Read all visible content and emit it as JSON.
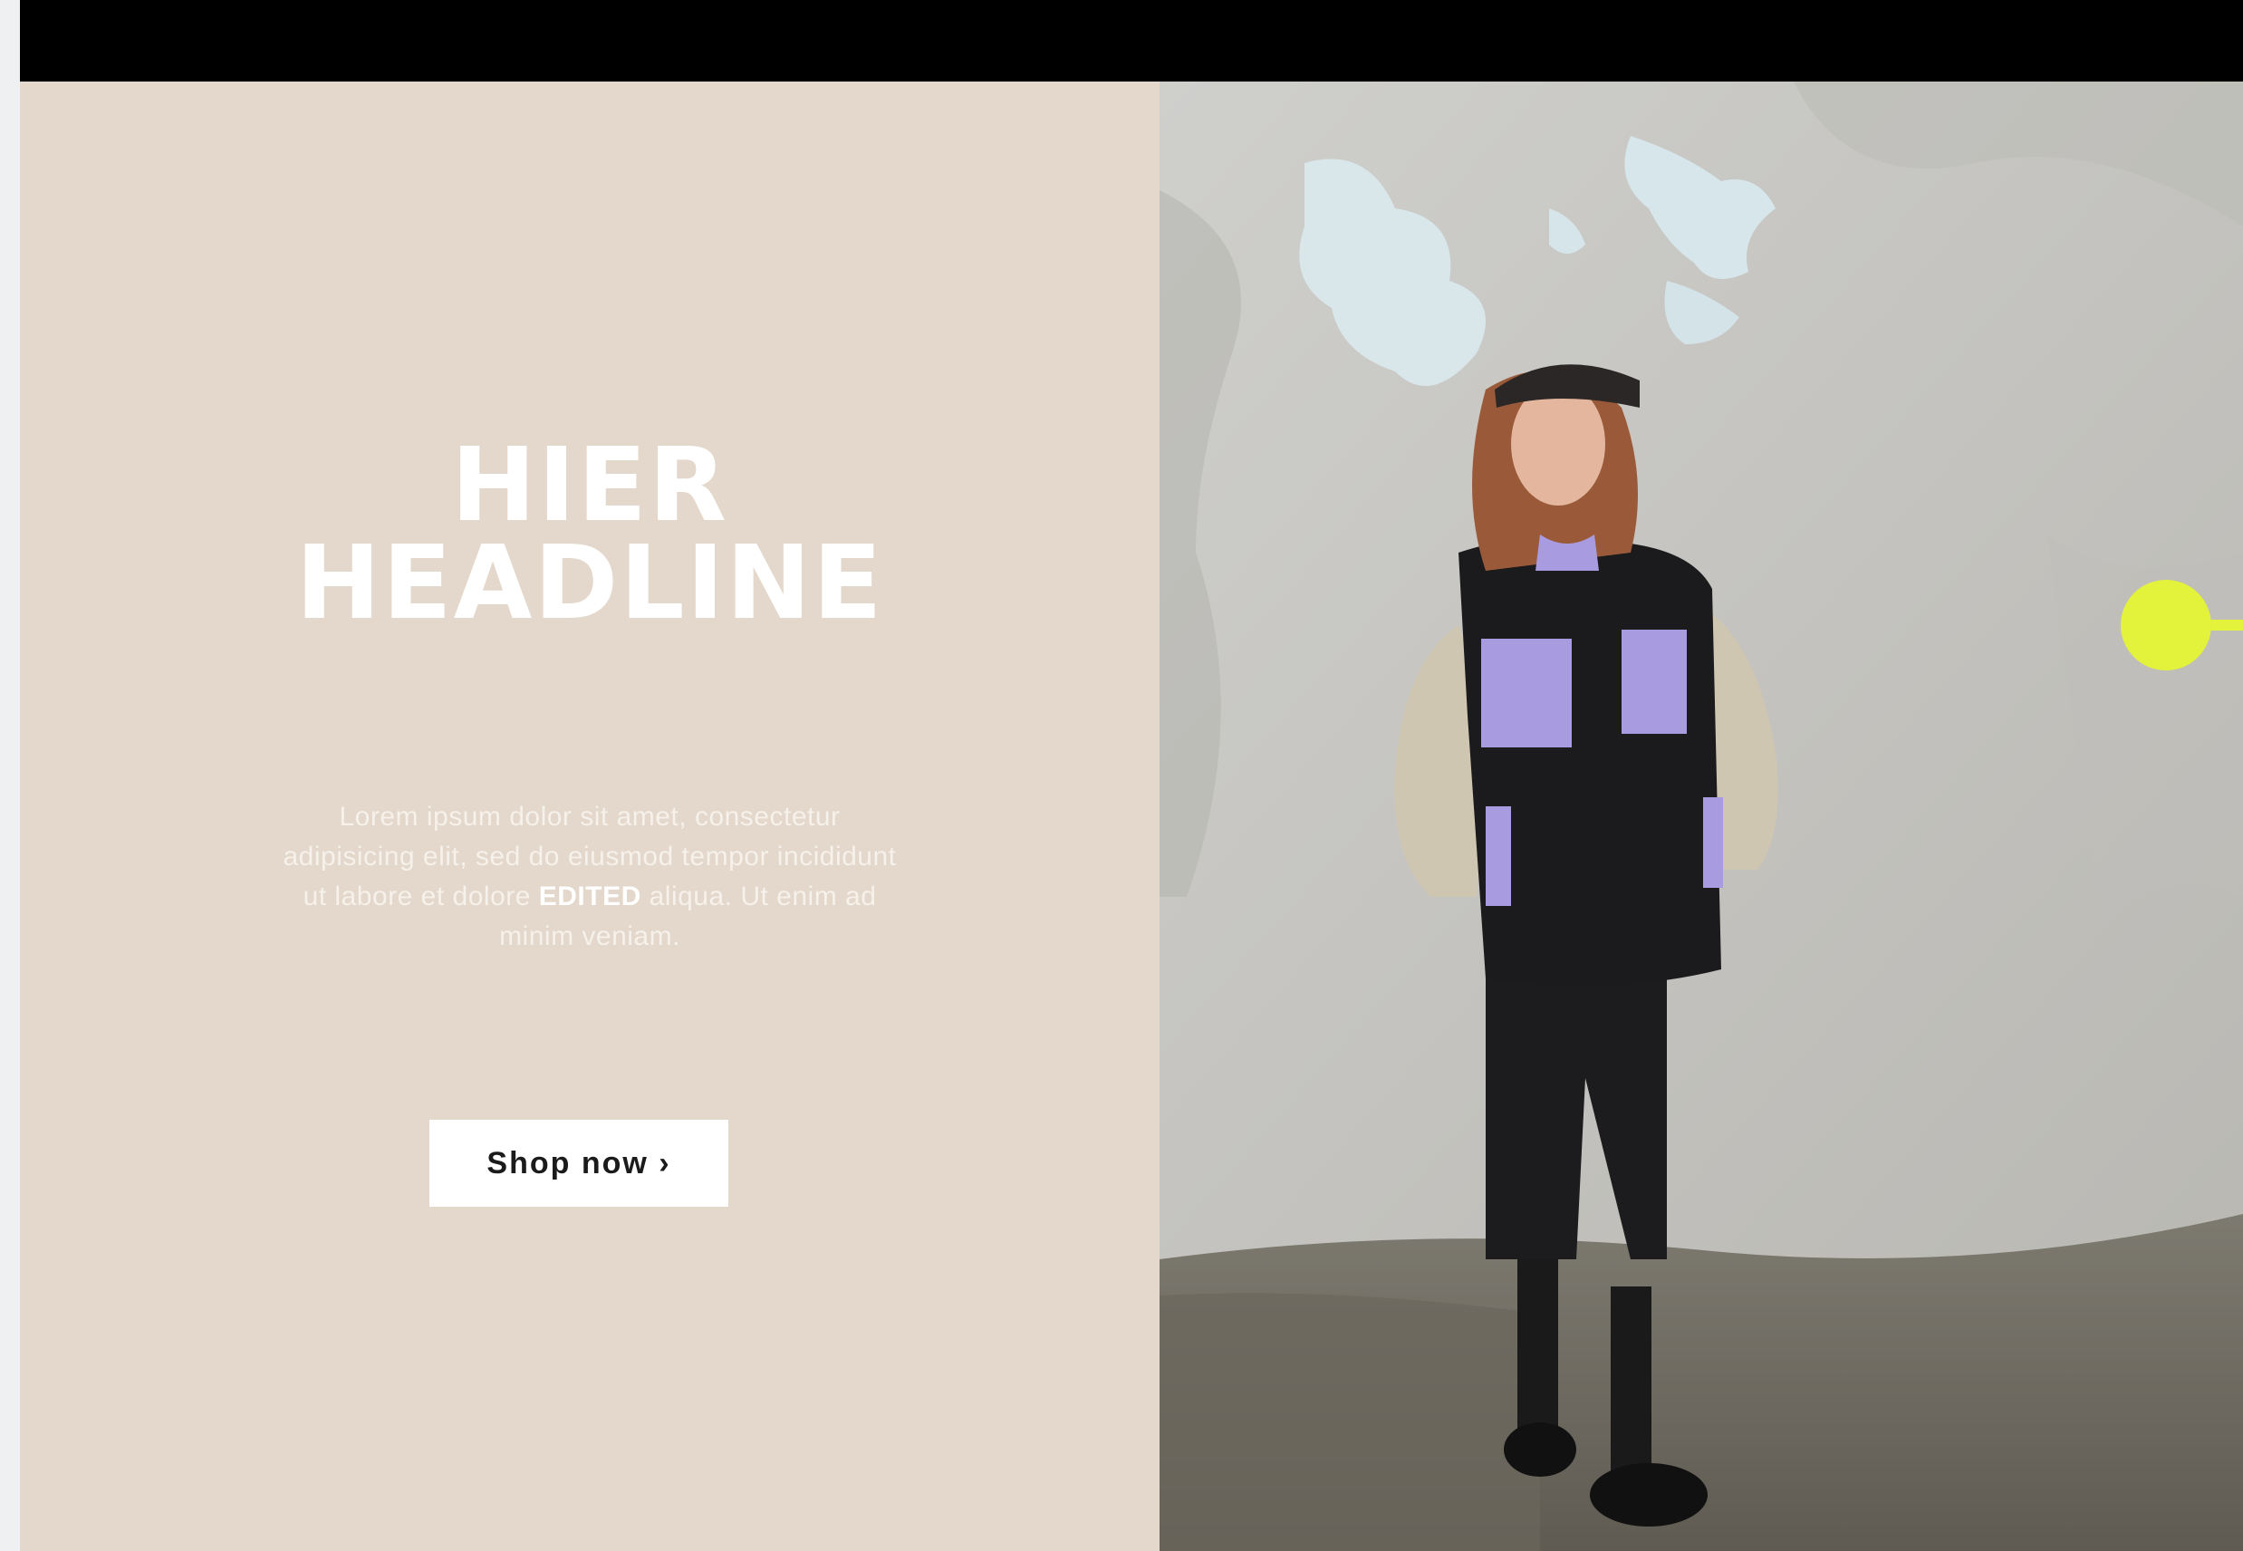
{
  "hero": {
    "headline_line1": "HIER",
    "headline_line2": "HEADLINE",
    "body_part1": "Lorem ipsum dolor sit amet, consectetur adipisicing elit, sed do eiusmod tempor incididunt ut labore et dolore ",
    "body_bold": "EDITED",
    "body_part2": " aliqua. Ut enim ad minim veniam.",
    "cta_label": "Shop now ›"
  },
  "colors": {
    "panel_background": "#e3d8cb",
    "top_bar": "#000000",
    "hotspot": "#e3f23a"
  },
  "image": {
    "subject": "model-in-parka-against-wall"
  }
}
